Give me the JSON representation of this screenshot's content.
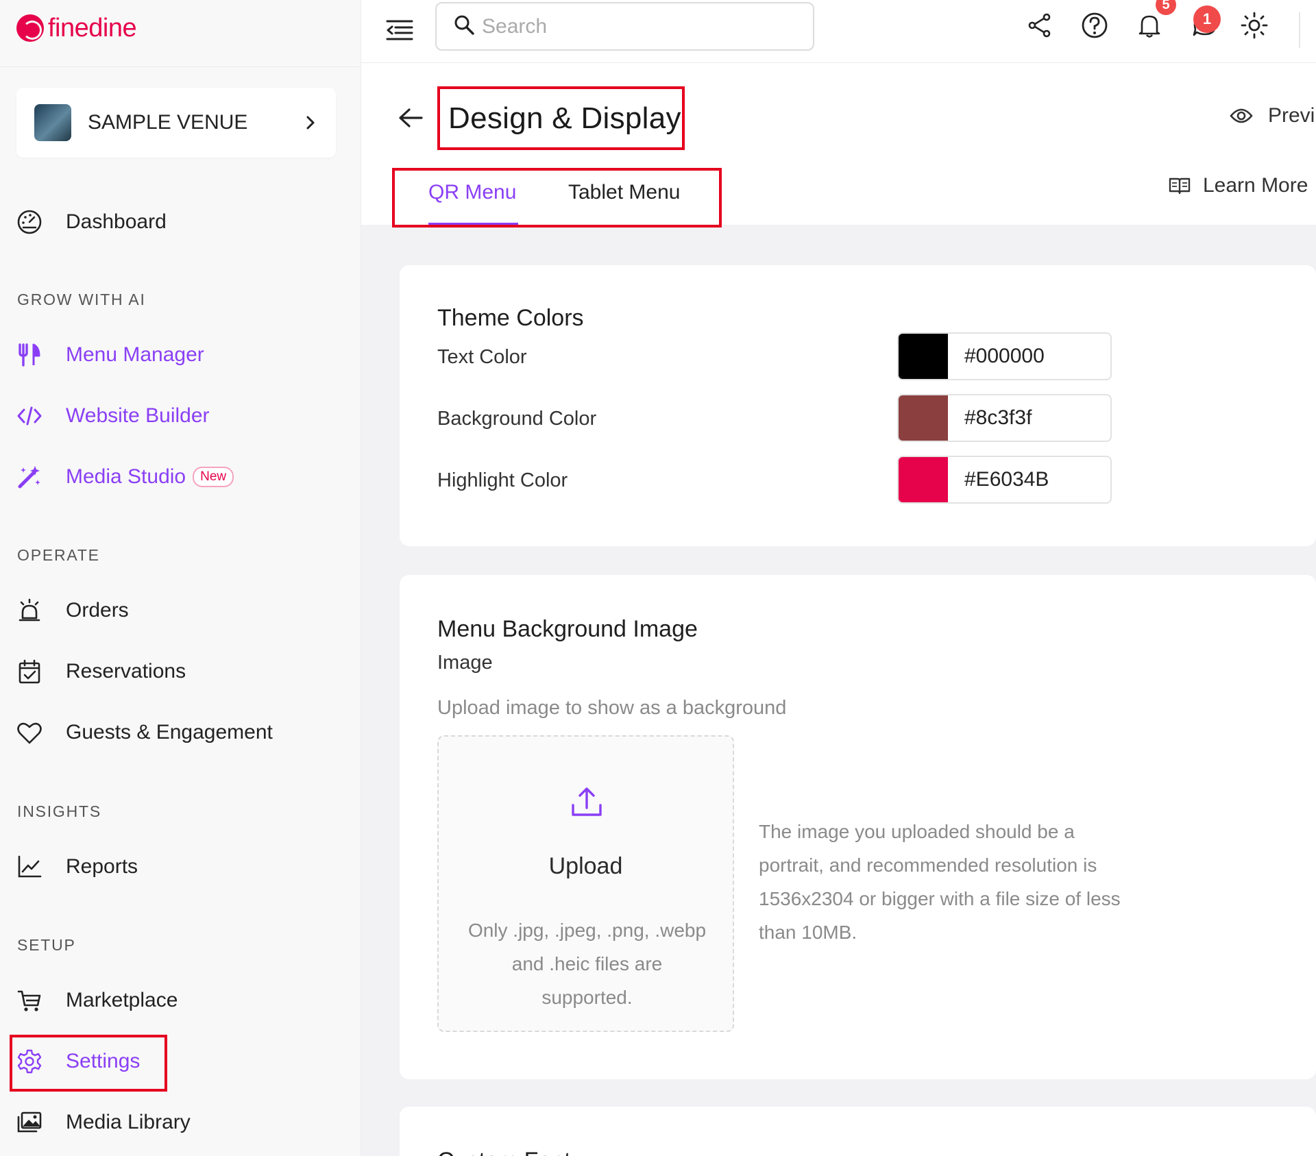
{
  "brand": {
    "name": "finedine",
    "color": "#e6034b",
    "accent": "#8a3ff5"
  },
  "sidebar": {
    "venue_name": "SAMPLE VENUE",
    "dashboard": "Dashboard",
    "sections": {
      "grow": "GROW WITH AI",
      "operate": "OPERATE",
      "insights": "INSIGHTS",
      "setup": "SETUP"
    },
    "items": {
      "menu_manager": "Menu Manager",
      "website_builder": "Website Builder",
      "media_studio": "Media Studio",
      "media_studio_badge": "New",
      "orders": "Orders",
      "reservations": "Reservations",
      "guests": "Guests & Engagement",
      "reports": "Reports",
      "marketplace": "Marketplace",
      "settings": "Settings",
      "media_library": "Media Library"
    }
  },
  "topbar": {
    "search_placeholder": "Search",
    "notifications_count": "5",
    "messages_count": "1",
    "icons": [
      "menu-toggle-icon",
      "search-icon",
      "share-icon",
      "help-icon",
      "bell-icon",
      "chat-icon",
      "theme-toggle-icon"
    ]
  },
  "page": {
    "title": "Design & Display",
    "preview_label": "Previ",
    "tabs": [
      {
        "label": "QR Menu",
        "active": true
      },
      {
        "label": "Tablet Menu",
        "active": false
      }
    ],
    "learn_more": "Learn More"
  },
  "theme_colors": {
    "title": "Theme Colors",
    "rows": [
      {
        "label": "Text Color",
        "value": "#000000",
        "swatch": "#000000"
      },
      {
        "label": "Background Color",
        "value": "#8c3f3f",
        "swatch": "#8c3f3f"
      },
      {
        "label": "Highlight Color",
        "value": "#E6034B",
        "swatch": "#E6034B"
      }
    ]
  },
  "background_image": {
    "title": "Menu Background Image",
    "field_label": "Image",
    "description": "Upload image to show as a background",
    "upload_label": "Upload",
    "upload_hint": "Only .jpg, .jpeg, .png, .webp and .heic files are supported.",
    "recommendation": "The image you uploaded should be a portrait, and recommended resolution is 1536x2304 or bigger with a file size of less than 10MB."
  },
  "custom_font": {
    "title": "Custom Font"
  }
}
